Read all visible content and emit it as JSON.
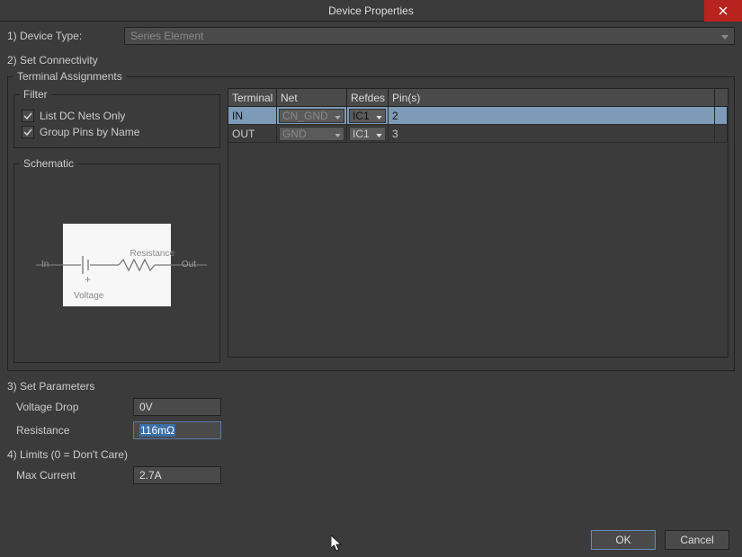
{
  "title": "Device Properties",
  "deviceType": {
    "label": "1) Device Type:",
    "value": "Series Element"
  },
  "setConnectivity": {
    "label": "2) Set Connectivity",
    "groupLabel": "Terminal Assignments",
    "filter": {
      "legend": "Filter",
      "listDcNets": {
        "label": "List DC Nets Only",
        "checked": true
      },
      "groupPins": {
        "label": "Group Pins by Name",
        "checked": true
      }
    },
    "schematic": {
      "legend": "Schematic",
      "inLabel": "In",
      "outLabel": "Out",
      "resistanceLabel": "Resistance",
      "voltageLabel": "Voltage",
      "plus": "+"
    },
    "table": {
      "headers": {
        "terminal": "Terminal",
        "net": "Net",
        "refdes": "Refdes",
        "pins": "Pin(s)"
      },
      "rows": [
        {
          "terminal": "IN",
          "net": "CN_GND",
          "refdes": "IC1",
          "pins": "2",
          "selected": true
        },
        {
          "terminal": "OUT",
          "net": "GND",
          "refdes": "IC1",
          "pins": "3",
          "selected": false
        }
      ]
    }
  },
  "setParameters": {
    "label": "3) Set Parameters",
    "voltageDrop": {
      "label": "Voltage Drop",
      "value": "0V"
    },
    "resistance": {
      "label": "Resistance",
      "value": "116mΩ",
      "focused": true
    }
  },
  "limits": {
    "label": "4) Limits (0 = Don't Care)",
    "maxCurrent": {
      "label": "Max Current",
      "value": "2.7A"
    }
  },
  "buttons": {
    "ok": "OK",
    "cancel": "Cancel"
  }
}
